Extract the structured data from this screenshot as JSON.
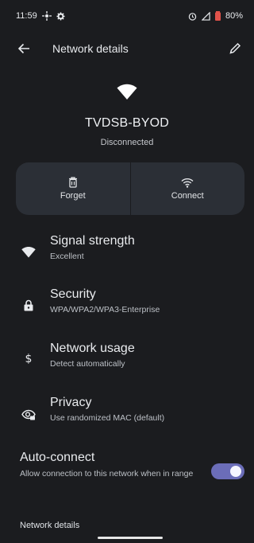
{
  "status_bar": {
    "time": "11:59",
    "battery_percent": "80%"
  },
  "app_bar": {
    "title": "Network details"
  },
  "network": {
    "ssid": "TVDSB-BYOD",
    "state": "Disconnected"
  },
  "actions": {
    "forget_label": "Forget",
    "connect_label": "Connect"
  },
  "details": [
    {
      "title": "Signal strength",
      "subtitle": "Excellent",
      "icon": "wifi-signal-icon"
    },
    {
      "title": "Security",
      "subtitle": "WPA/WPA2/WPA3-Enterprise",
      "icon": "lock-icon"
    },
    {
      "title": "Network usage",
      "subtitle": "Detect automatically",
      "icon": "dollar-icon"
    },
    {
      "title": "Privacy",
      "subtitle": "Use randomized MAC (default)",
      "icon": "privacy-eye-icon"
    }
  ],
  "auto_connect": {
    "title": "Auto-connect",
    "subtitle": "Allow connection to this network when in range",
    "enabled": true
  },
  "section_label": "Network details",
  "colors": {
    "background": "#1b1c1f",
    "card": "#2b2f36",
    "toggle_on": "#6b6db8",
    "battery_low": "#e0524a"
  }
}
